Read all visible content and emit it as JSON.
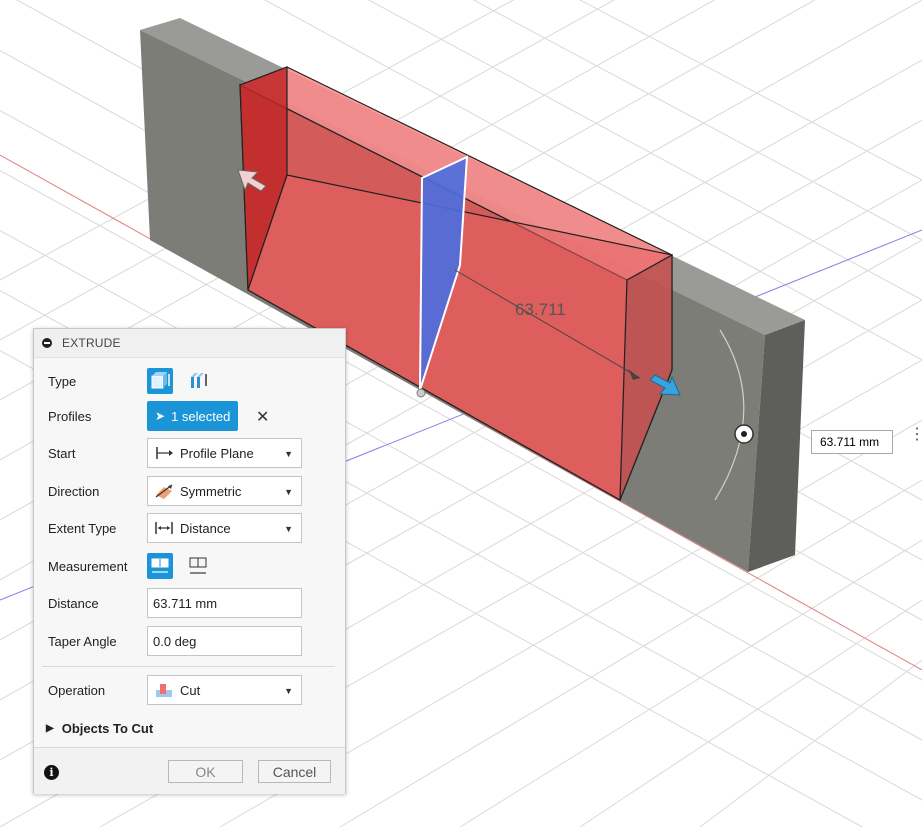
{
  "viewport": {
    "dimension_label": "63.711",
    "dimension_input": "63.711 mm"
  },
  "dialog": {
    "title": "EXTRUDE",
    "type_label": "Type",
    "profiles_label": "Profiles",
    "profiles_value": "1 selected",
    "start_label": "Start",
    "start_value": "Profile Plane",
    "direction_label": "Direction",
    "direction_value": "Symmetric",
    "extent_label": "Extent Type",
    "extent_value": "Distance",
    "measurement_label": "Measurement",
    "distance_label": "Distance",
    "distance_value": "63.711 mm",
    "taper_label": "Taper Angle",
    "taper_value": "0.0 deg",
    "operation_label": "Operation",
    "operation_value": "Cut",
    "objects_to_cut": "Objects To Cut",
    "ok": "OK",
    "cancel": "Cancel"
  },
  "colors": {
    "accent": "#1b95d8",
    "cut_body": "#ff6b6b",
    "profile_plane": "#4a6ee0",
    "solid": "#7d7d78"
  }
}
